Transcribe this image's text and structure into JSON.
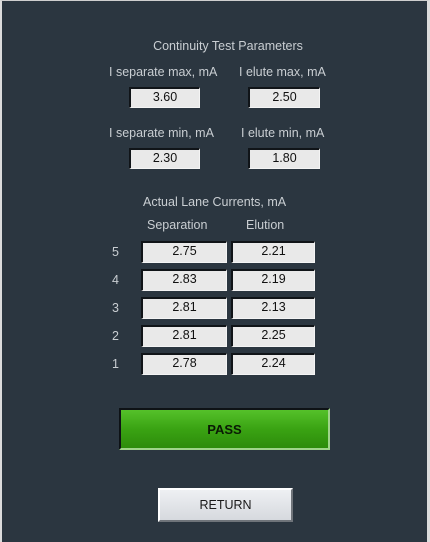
{
  "params": {
    "title": "Continuity Test Parameters",
    "sep_max_label": "I separate max, mA",
    "elute_max_label": "I elute max, mA",
    "sep_max": "3.60",
    "elute_max": "2.50",
    "sep_min_label": "I separate min, mA",
    "elute_min_label": "I elute min, mA",
    "sep_min": "2.30",
    "elute_min": "1.80"
  },
  "currents": {
    "title": "Actual Lane Currents, mA",
    "col_separation": "Separation",
    "col_elution": "Elution",
    "rows": [
      {
        "lane": "5",
        "separation": "2.75",
        "elution": "2.21"
      },
      {
        "lane": "4",
        "separation": "2.83",
        "elution": "2.19"
      },
      {
        "lane": "3",
        "separation": "2.81",
        "elution": "2.13"
      },
      {
        "lane": "2",
        "separation": "2.81",
        "elution": "2.25"
      },
      {
        "lane": "1",
        "separation": "2.78",
        "elution": "2.24"
      }
    ]
  },
  "result": {
    "label": "PASS",
    "color": "#3aa313"
  },
  "actions": {
    "return_label": "RETURN"
  }
}
